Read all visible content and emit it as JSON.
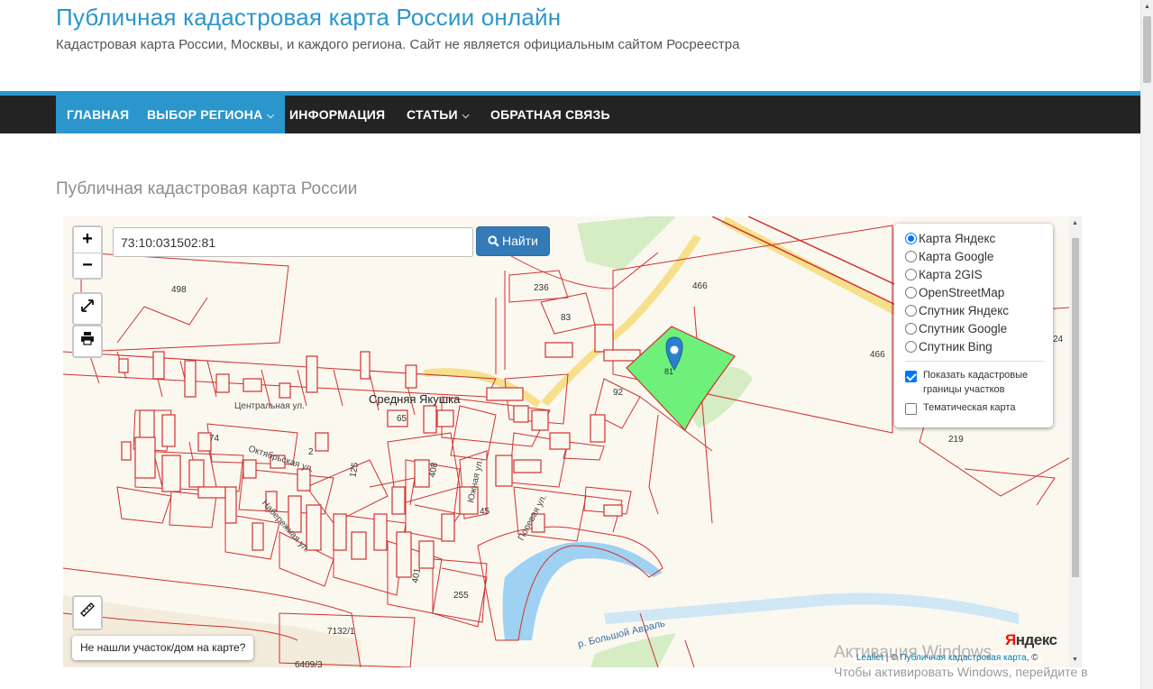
{
  "site": {
    "title": "Публичная кадастровая карта России онлайн",
    "description": "Кадастровая карта России, Москвы, и каждого региона. Сайт не является официальным сайтом Росреестра"
  },
  "nav": {
    "items": [
      {
        "label": "ГЛАВНАЯ",
        "active": true
      },
      {
        "label": "ВЫБОР РЕГИОНА",
        "active": true,
        "has_dropdown": true
      },
      {
        "label": "ИНФОРМАЦИЯ",
        "active": false
      },
      {
        "label": "СТАТЬИ",
        "active": false,
        "has_dropdown": true
      },
      {
        "label": "ОБРАТНАЯ СВЯЗЬ",
        "active": false
      }
    ]
  },
  "page": {
    "heading": "Публичная кадастровая карта России"
  },
  "map": {
    "search": {
      "value": "73:10:031502:81",
      "button_label": "Найти",
      "button_icon": "search-icon"
    },
    "controls": {
      "zoom_in": "+",
      "zoom_out": "−"
    },
    "layers": {
      "options": [
        {
          "label": "Карта Яндекс",
          "selected": true
        },
        {
          "label": "Карта Google",
          "selected": false
        },
        {
          "label": "Карта 2GIS",
          "selected": false
        },
        {
          "label": "OpenStreetMap",
          "selected": false
        },
        {
          "label": "Спутник Яндекс",
          "selected": false
        },
        {
          "label": "Спутник Google",
          "selected": false
        },
        {
          "label": "Спутник Bing",
          "selected": false
        }
      ],
      "overlays": [
        {
          "label": "Показать кадастровые границы участков",
          "checked": true
        },
        {
          "label": "Тематическая карта",
          "checked": false
        }
      ]
    },
    "not_found_label": "Не нашли участок/дом на карте?",
    "labels": {
      "village": "Средняя Якушка",
      "street_central": "Центральная ул.",
      "street_oct": "Октябрьская ул.",
      "street_nab": "Набережная ул.",
      "street_south": "Южная ул.",
      "street_field": "Полевая ул.",
      "river": "р. Большой Авраль",
      "parcels": {
        "p498": "498",
        "p236": "236",
        "p83": "83",
        "p466a": "466",
        "p466b": "466",
        "p24": "24",
        "p81": "81",
        "p92": "92",
        "p65": "65",
        "p74": "74",
        "p2": "2",
        "p125": "125",
        "p408": "408",
        "p45": "45",
        "p401": "401",
        "p255": "255",
        "p219": "219",
        "p7132": "7132/1",
        "p6409": "6409/3"
      }
    },
    "attribution": {
      "leaflet": "Leaflet",
      "sep": " | © ",
      "site": "Публичная кадастровая карта",
      "tail": ", ©"
    },
    "provider_logo": {
      "first": "Я",
      "rest": "ндекс"
    },
    "colors": {
      "parcel_border": "#d0312d",
      "selected_parcel": "#6ef07a",
      "water": "#9fd1f2",
      "green": "#d5ecc4",
      "road": "#f6e08c",
      "marker": "#2a81cb"
    }
  },
  "windows_activation": {
    "title": "Активация Windows",
    "text": "Чтобы активировать Windows, перейдите в"
  }
}
